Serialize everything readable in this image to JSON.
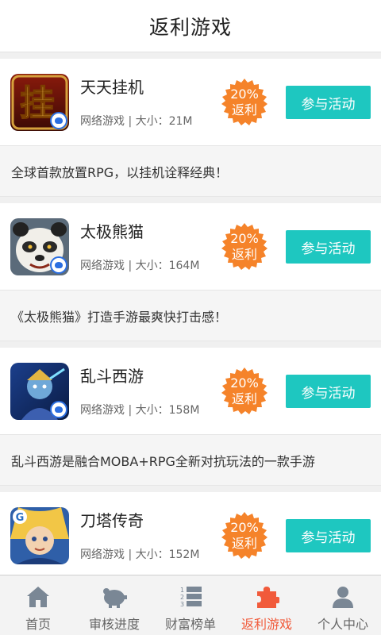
{
  "header": {
    "title": "返利游戏"
  },
  "games": [
    {
      "name": "天天挂机",
      "meta": "网络游戏 | 大小：21M",
      "rebate_percent": "20%",
      "rebate_label": "返利",
      "join_label": "参与活动",
      "description": "全球首款放置RPG，以挂机诠释经典！",
      "icon": "tiantian-guaji-game-icon"
    },
    {
      "name": "太极熊猫",
      "meta": "网络游戏 | 大小：164M",
      "rebate_percent": "20%",
      "rebate_label": "返利",
      "join_label": "参与活动",
      "description": "《太极熊猫》打造手游最爽快打击感！",
      "icon": "taiji-xiongmao-game-icon"
    },
    {
      "name": "乱斗西游",
      "meta": "网络游戏 | 大小：158M",
      "rebate_percent": "20%",
      "rebate_label": "返利",
      "join_label": "参与活动",
      "description": "乱斗西游是融合MOBA+RPG全新对抗玩法的一款手游",
      "icon": "luandou-xiyou-game-icon"
    },
    {
      "name": "刀塔传奇",
      "meta": "网络游戏 | 大小：152M",
      "rebate_percent": "20%",
      "rebate_label": "返利",
      "join_label": "参与活动",
      "icon": "daota-chuanqi-game-icon"
    }
  ],
  "tabbar": {
    "items": [
      {
        "label": "首页",
        "icon": "home-icon"
      },
      {
        "label": "审核进度",
        "icon": "piggy-bank-icon"
      },
      {
        "label": "财富榜单",
        "icon": "ranking-list-icon"
      },
      {
        "label": "返利游戏",
        "icon": "puzzle-icon"
      },
      {
        "label": "个人中心",
        "icon": "user-icon"
      }
    ],
    "active_index": 3
  },
  "colors": {
    "accent": "#1ec7c0",
    "rebate_badge": "#f5832a",
    "active_tab": "#f15a3a"
  }
}
